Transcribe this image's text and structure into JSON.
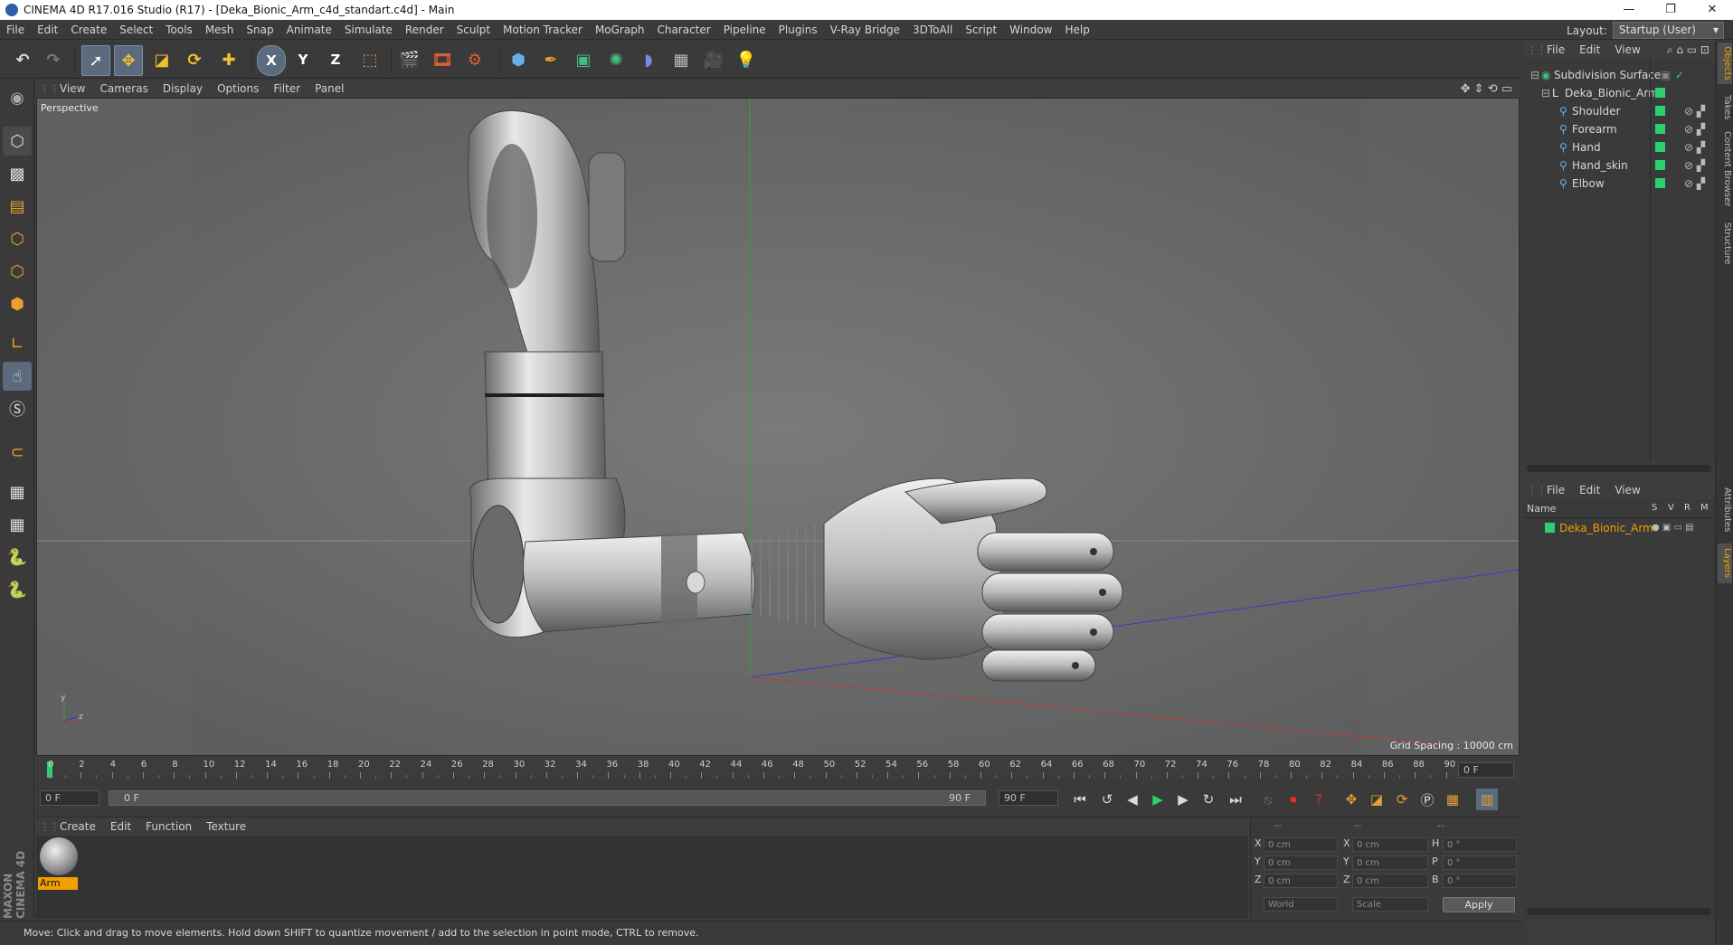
{
  "window": {
    "title": "CINEMA 4D R17.016 Studio (R17) - [Deka_Bionic_Arm_c4d_standart.c4d] - Main",
    "controls": [
      "—",
      "❐",
      "✕"
    ]
  },
  "menubar": {
    "items": [
      "File",
      "Edit",
      "Create",
      "Select",
      "Tools",
      "Mesh",
      "Snap",
      "Animate",
      "Simulate",
      "Render",
      "Sculpt",
      "Motion Tracker",
      "MoGraph",
      "Character",
      "Pipeline",
      "Plugins",
      "V-Ray Bridge",
      "3DToAll",
      "Script",
      "Window",
      "Help"
    ],
    "layout_label": "Layout:",
    "layout_value": "Startup (User)"
  },
  "toolbar": {
    "axis_x": "X",
    "axis_y": "Y",
    "axis_z": "Z"
  },
  "viewport": {
    "menu": [
      "View",
      "Cameras",
      "Display",
      "Options",
      "Filter",
      "Panel"
    ],
    "camera_label": "Perspective",
    "grid_spacing": "Grid Spacing : 10000 cm",
    "axis_y_label": "y",
    "axis_z_label": "z"
  },
  "timeline": {
    "ticks": [
      "0",
      "2",
      "4",
      "6",
      "8",
      "10",
      "12",
      "14",
      "16",
      "18",
      "20",
      "22",
      "24",
      "26",
      "28",
      "30",
      "32",
      "34",
      "36",
      "38",
      "40",
      "42",
      "44",
      "46",
      "48",
      "50",
      "52",
      "54",
      "56",
      "58",
      "60",
      "62",
      "64",
      "66",
      "68",
      "70",
      "72",
      "74",
      "76",
      "78",
      "80",
      "82",
      "84",
      "86",
      "88",
      "90"
    ],
    "current_frame": "0 F"
  },
  "transport": {
    "start_field": "0 F",
    "range_start": "0 F",
    "range_end": "90 F",
    "end_field": "90 F"
  },
  "material_manager": {
    "menu": [
      "Create",
      "Edit",
      "Function",
      "Texture"
    ],
    "materials": [
      {
        "name": "Arm"
      }
    ]
  },
  "coordinates": {
    "header": [
      "--",
      "--",
      "--"
    ],
    "rows": [
      {
        "a": "X",
        "a_val": "0 cm",
        "b": "X",
        "b_val": "0 cm",
        "c": "H",
        "c_val": "0 °"
      },
      {
        "a": "Y",
        "a_val": "0 cm",
        "b": "Y",
        "b_val": "0 cm",
        "c": "P",
        "c_val": "0 °"
      },
      {
        "a": "Z",
        "a_val": "0 cm",
        "b": "Z",
        "b_val": "0 cm",
        "c": "B",
        "c_val": "0 °"
      }
    ],
    "mode_world": "World",
    "mode_scale": "Scale",
    "apply_label": "Apply"
  },
  "statusbar": {
    "text": "Move: Click and drag to move elements. Hold down SHIFT to quantize movement / add to the selection in point mode, CTRL to remove."
  },
  "object_manager": {
    "menu": [
      "File",
      "Edit",
      "View"
    ],
    "objects": [
      {
        "name": "Subdivision Surface",
        "level": 0
      },
      {
        "name": "Deka_Bionic_Arm",
        "level": 1
      },
      {
        "name": "Shoulder",
        "level": 2
      },
      {
        "name": "Forearm",
        "level": 2
      },
      {
        "name": "Hand",
        "level": 2
      },
      {
        "name": "Hand_skin",
        "level": 2
      },
      {
        "name": "Elbow",
        "level": 2
      }
    ]
  },
  "layer_manager": {
    "menu": [
      "File",
      "Edit",
      "View"
    ],
    "columns": [
      "Name",
      "S",
      "V",
      "R",
      "M"
    ],
    "layers": [
      {
        "name": "Deka_Bionic_Arm"
      }
    ]
  },
  "side_tabs": [
    "Objects",
    "Takes",
    "Content Browser",
    "Structure",
    "Attributes",
    "Layers"
  ],
  "branding": "MAXON CINEMA 4D"
}
